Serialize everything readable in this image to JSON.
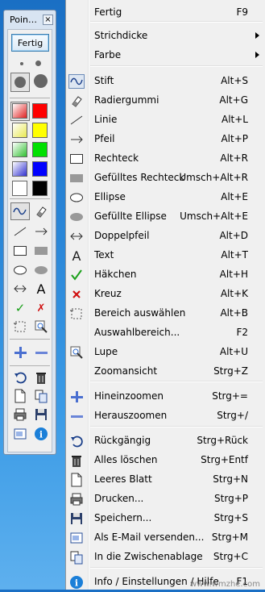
{
  "palette": {
    "title": "Poin…",
    "close": "×",
    "done_button": "Fertig",
    "color_swatches": [
      "#e02020",
      "#ff0000",
      "#e8e850",
      "#ffff00",
      "#30c030",
      "#00e000",
      "#3030d0",
      "#0000ff",
      "#ffffff",
      "#000000"
    ]
  },
  "menu": {
    "items": [
      {
        "label": "Fertig",
        "shortcut": "F9"
      },
      {
        "label": "Strichdicke",
        "shortcut": ""
      },
      {
        "label": "Farbe",
        "shortcut": ""
      },
      {
        "label": "Stift",
        "shortcut": "Alt+S"
      },
      {
        "label": "Radiergummi",
        "shortcut": "Alt+G"
      },
      {
        "label": "Linie",
        "shortcut": "Alt+L"
      },
      {
        "label": "Pfeil",
        "shortcut": "Alt+P"
      },
      {
        "label": "Rechteck",
        "shortcut": "Alt+R"
      },
      {
        "label": "Gefülltes Rechteck",
        "shortcut": "Umsch+Alt+R"
      },
      {
        "label": "Ellipse",
        "shortcut": "Alt+E"
      },
      {
        "label": "Gefüllte Ellipse",
        "shortcut": "Umsch+Alt+E"
      },
      {
        "label": "Doppelpfeil",
        "shortcut": "Alt+D"
      },
      {
        "label": "Text",
        "shortcut": "Alt+T"
      },
      {
        "label": "Häkchen",
        "shortcut": "Alt+H"
      },
      {
        "label": "Kreuz",
        "shortcut": "Alt+K"
      },
      {
        "label": "Bereich auswählen",
        "shortcut": "Alt+B"
      },
      {
        "label": "Auswahlbereich...",
        "shortcut": "F2"
      },
      {
        "label": "Lupe",
        "shortcut": "Alt+U"
      },
      {
        "label": "Zoomansicht",
        "shortcut": "Strg+Z"
      },
      {
        "label": "Hineinzoomen",
        "shortcut": "Strg+="
      },
      {
        "label": "Herauszoomen",
        "shortcut": "Strg+/"
      },
      {
        "label": "Rückgängig",
        "shortcut": "Strg+Rück"
      },
      {
        "label": "Alles löschen",
        "shortcut": "Strg+Entf"
      },
      {
        "label": "Leeres Blatt",
        "shortcut": "Strg+N"
      },
      {
        "label": "Drucken...",
        "shortcut": "Strg+P"
      },
      {
        "label": "Speichern...",
        "shortcut": "Strg+S"
      },
      {
        "label": "Als E-Mail versenden...",
        "shortcut": "Strg+M"
      },
      {
        "label": "In die Zwischenablage",
        "shortcut": "Strg+C"
      },
      {
        "label": "Info / Einstellungen / Hilfe",
        "shortcut": "F1"
      }
    ]
  },
  "watermark": "www.wmzhe.com",
  "colors": {
    "accent": "#2a86d8",
    "check": "#1aa01a",
    "cross": "#d01010",
    "info": "#1b7fd8"
  }
}
